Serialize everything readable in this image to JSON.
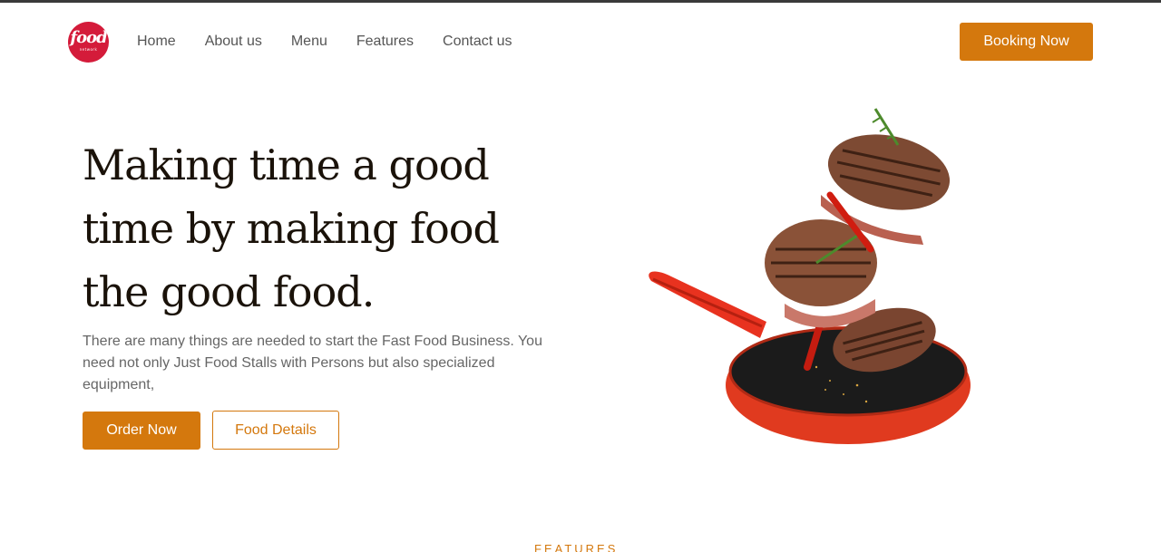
{
  "brand": {
    "logo_text": "food",
    "logo_subtext": "network",
    "logo_color": "#d41b3a"
  },
  "nav": {
    "items": [
      {
        "label": "Home"
      },
      {
        "label": "About us"
      },
      {
        "label": "Menu"
      },
      {
        "label": "Features"
      },
      {
        "label": "Contact us"
      }
    ]
  },
  "header": {
    "booking_label": "Booking Now"
  },
  "hero": {
    "title_lines": [
      "Making time a good",
      "time by making food",
      "the good food."
    ],
    "description": "There are many things are needed to start the Fast Food Business. You need not only Just Food Stalls with Persons but also specialized equipment,",
    "order_label": "Order Now",
    "details_label": "Food Details",
    "image_icon": "frying-pan-with-steaks-illustration"
  },
  "section": {
    "features_label": "FEATURES"
  },
  "colors": {
    "accent": "#d4780d",
    "heading": "#1a1209",
    "body_text": "#666666"
  }
}
